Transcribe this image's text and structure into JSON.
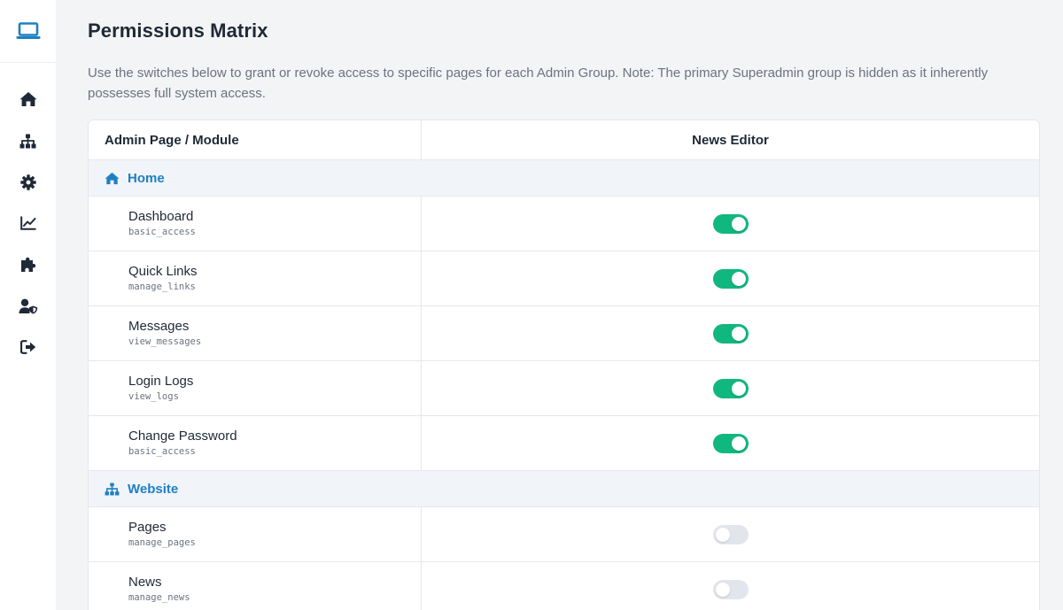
{
  "sidebar": {
    "items": [
      {
        "name": "home-icon"
      },
      {
        "name": "sitemap-icon"
      },
      {
        "name": "gear-icon"
      },
      {
        "name": "chart-line-icon"
      },
      {
        "name": "puzzle-icon"
      },
      {
        "name": "user-shield-icon"
      },
      {
        "name": "logout-icon"
      }
    ]
  },
  "page": {
    "title": "Permissions Matrix",
    "description": "Use the switches below to grant or revoke access to specific pages for each Admin Group. Note: The primary Superadmin group is hidden as it inherently possesses full system access."
  },
  "matrix": {
    "col_module": "Admin Page / Module",
    "col_group": "News Editor",
    "sections": [
      {
        "label": "Home",
        "icon": "home-icon",
        "rows": [
          {
            "name": "Dashboard",
            "code": "basic_access",
            "enabled": true
          },
          {
            "name": "Quick Links",
            "code": "manage_links",
            "enabled": true
          },
          {
            "name": "Messages",
            "code": "view_messages",
            "enabled": true
          },
          {
            "name": "Login Logs",
            "code": "view_logs",
            "enabled": true
          },
          {
            "name": "Change Password",
            "code": "basic_access",
            "enabled": true
          }
        ]
      },
      {
        "label": "Website",
        "icon": "sitemap-icon",
        "rows": [
          {
            "name": "Pages",
            "code": "manage_pages",
            "enabled": false
          },
          {
            "name": "News",
            "code": "manage_news",
            "enabled": false
          }
        ]
      }
    ]
  },
  "colors": {
    "accent": "#1d80c3",
    "switch_on": "#10b77f",
    "switch_off": "#e2e6ec"
  }
}
